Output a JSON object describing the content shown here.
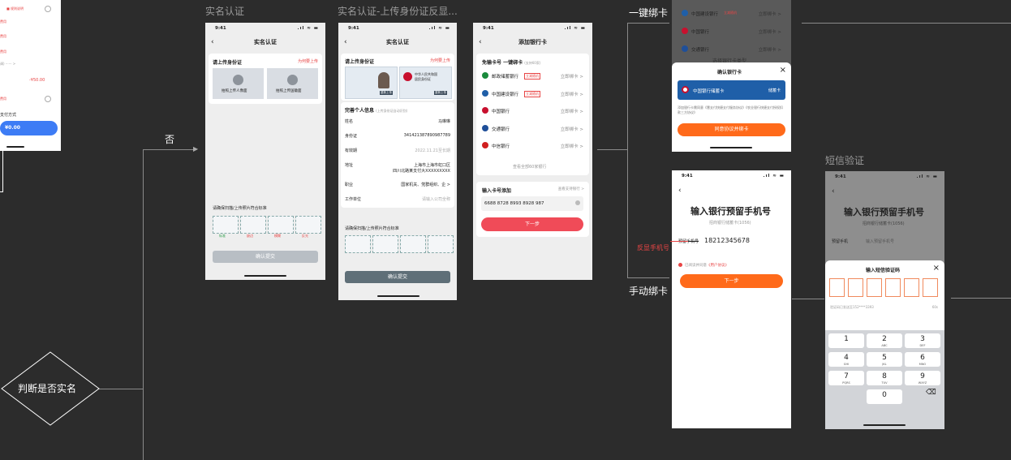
{
  "frames": {
    "real_name": {
      "title": "实名认证"
    },
    "upload_id": {
      "title": "实名认证-上传身份证反显..."
    },
    "sms": {
      "title": "短信验证"
    }
  },
  "status": {
    "time": "9:41",
    "icons": ".ıl ≈ ▬"
  },
  "labels": {
    "no_branch": "否",
    "decision": "判断是否实名",
    "one_click_bind": "一键绑卡",
    "manual_bind": "手动绑卡",
    "echo_phone": "反显手机号"
  },
  "left_partial": {
    "red_tag": "(",
    "amount1": "-¥50.00",
    "payment_method": "支付方式",
    "pay_amount": "¥0.00",
    "strike": "¥0.00"
  },
  "real_name_screen": {
    "nav_title": "实名认证",
    "section_title": "请上传身份证",
    "why_upload": "为何要上传",
    "front_label": "拍照上传人像面",
    "back_label": "拍照上传国徽面",
    "guide": "请确保扫描/上传照片符合标准",
    "thumb_labels": [
      "标准",
      "缺边",
      "模糊",
      "反光"
    ],
    "submit": "确认提交"
  },
  "upload_screen": {
    "nav_title": "实名认证",
    "section_title": "请上传身份证",
    "why_upload": "为何要上传",
    "id_card_title": "中华人民共和国\n居民身份证",
    "reupload": "重新上传",
    "info_title": "完善个人信息",
    "info_hint": "(上传身份证自动识别)",
    "rows": [
      {
        "k": "姓名",
        "v": "马琳琳"
      },
      {
        "k": "身份证",
        "v": "341421387890987789"
      },
      {
        "k": "有效期",
        "v": "2022.11.21至长期"
      },
      {
        "k": "地址",
        "v": "上海市上海市虹口区\n四川北路某支付大XXXXXXXXX"
      },
      {
        "k": "职业",
        "v": "国家机关、党群组织、企 >"
      },
      {
        "k": "工作单位",
        "v": "请输入公司全称"
      }
    ],
    "guide": "请确保扫描/上传照片符合标准",
    "submit": "确认提交"
  },
  "add_card_screen": {
    "nav_title": "添加银行卡",
    "one_click_title": "免输卡号 一键绑卡",
    "one_click_hint": "(支持60家)",
    "banks": [
      {
        "name": "邮政储蓄银行",
        "tag": "立减随机",
        "action": "立即绑卡 >",
        "color": "#1a8a3c"
      },
      {
        "name": "中国建设银行",
        "tag": "立减随机",
        "action": "立即绑卡 >",
        "color": "#1f5fa8"
      },
      {
        "name": "中国银行",
        "tag": "",
        "action": "立即绑卡 >",
        "color": "#c8102e"
      },
      {
        "name": "交通银行",
        "tag": "",
        "action": "立即绑卡 >",
        "color": "#1f4f99"
      },
      {
        "name": "中信银行",
        "tag": "",
        "action": "立即绑卡 >",
        "color": "#d02020"
      }
    ],
    "view_all": "查看全部60家银行",
    "input_title": "输入卡号添加",
    "supported": "查看支持银行 >",
    "card_number": "6688 8728 8993 8928 987",
    "next": "下一步"
  },
  "confirm_screen": {
    "top_banks": [
      {
        "name": "中国建设银行",
        "tag": "立减随机",
        "action": "立即绑卡 >"
      },
      {
        "name": "中国银行",
        "tag": "",
        "action": "立即绑卡 >"
      },
      {
        "name": "交通银行",
        "tag": "",
        "action": "立即绑卡 >"
      }
    ],
    "behind_title": "选择银行卡类型",
    "modal_title": "确认银行卡",
    "card_name": "中国银行储蓄卡",
    "card_action": "储蓄卡",
    "agreement": "添加银行卡需同意《慧支付快捷支付服务协议》《农业银行快捷支付授权扣款三方协议》",
    "confirm": "同意协议并绑卡"
  },
  "phone_screen": {
    "title": "输入银行预留手机号",
    "subtitle": "招商银行储蓄卡(1056)",
    "field_label": "预留手机号",
    "phone": "18212345678",
    "agree_prefix": "已阅读并同意",
    "agree_link": "《用户协议》",
    "next": "下一步"
  },
  "sms_screen": {
    "title": "输入银行预留手机号",
    "subtitle": "招商银行储蓄卡(1056)",
    "field_label": "预留手机",
    "field_placeholder": "输入预留手机号",
    "modal_title": "输入短信验证码",
    "sent_to": "验证码已发送至152****3393",
    "countdown": "60s",
    "keys": [
      {
        "n": "1",
        "l": ""
      },
      {
        "n": "2",
        "l": "ABC"
      },
      {
        "n": "3",
        "l": "DEF"
      },
      {
        "n": "4",
        "l": "GHI"
      },
      {
        "n": "5",
        "l": "JKL"
      },
      {
        "n": "6",
        "l": "MNO"
      },
      {
        "n": "7",
        "l": "PQRS"
      },
      {
        "n": "8",
        "l": "TUV"
      },
      {
        "n": "9",
        "l": "WXYZ"
      },
      {
        "n": "0",
        "l": ""
      }
    ]
  },
  "colors": {
    "background": "#2c2c2c",
    "accent": "#ff6a1a",
    "red": "#e84545",
    "blue": "#1f5fa8"
  }
}
